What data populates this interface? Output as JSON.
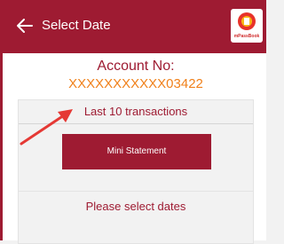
{
  "header": {
    "title": "Select Date",
    "back_icon": "arrow-left-icon",
    "logo_text": "mPassBook"
  },
  "account": {
    "label": "Account No:",
    "number": "XXXXXXXXXXX03422"
  },
  "transactions_card": {
    "heading": "Last 10 transactions",
    "button_label": "Mini Statement"
  },
  "dates_card": {
    "heading": "Please select dates"
  },
  "colors": {
    "brand": "#9e1b32",
    "accent": "#f0801a",
    "annotation_arrow": "#e53935"
  }
}
